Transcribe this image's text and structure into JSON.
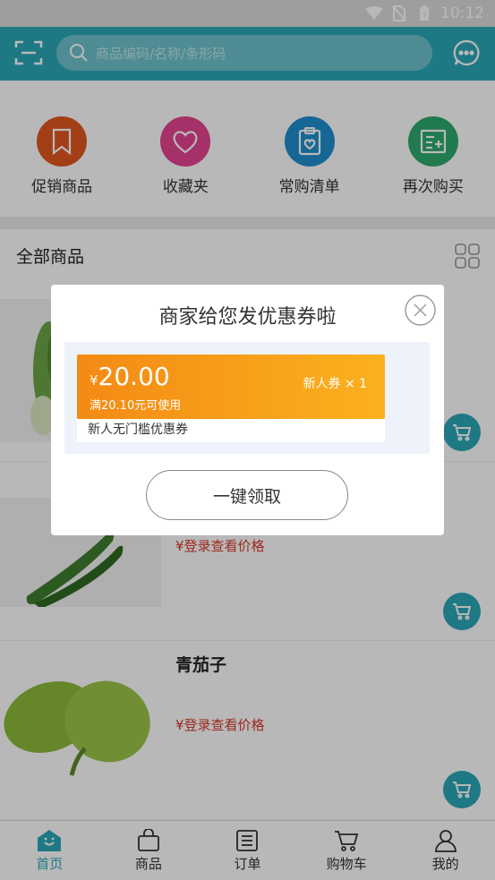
{
  "status_bar": {
    "time": "10:12"
  },
  "header": {
    "search_placeholder": "商品编码/名称/条形码"
  },
  "quick_links": [
    {
      "label": "促销商品",
      "color": "#e2581f"
    },
    {
      "label": "收藏夹",
      "color": "#e54590"
    },
    {
      "label": "常购清单",
      "color": "#1f8fd0"
    },
    {
      "label": "再次购买",
      "color": "#2dab6c"
    }
  ],
  "section": {
    "title": "全部商品"
  },
  "products": [
    {
      "name": "",
      "price": ""
    },
    {
      "name": "",
      "price": "¥登录查看价格"
    },
    {
      "name": "青茄子",
      "price": "¥登录查看价格"
    }
  ],
  "tabs": [
    {
      "label": "首页"
    },
    {
      "label": "商品"
    },
    {
      "label": "订单"
    },
    {
      "label": "购物车"
    },
    {
      "label": "我的"
    }
  ],
  "dialog": {
    "title": "商家给您发优惠券啦",
    "coupon": {
      "currency": "¥",
      "amount": "20.00",
      "condition": "满20.10元可使用",
      "type": "新人券 × 1",
      "description": "新人无门槛优惠券"
    },
    "claim_button": "一键领取"
  },
  "colors": {
    "accent": "#2aa8b9",
    "price": "#d93a2b",
    "coupon_orange": "#f48a14"
  }
}
